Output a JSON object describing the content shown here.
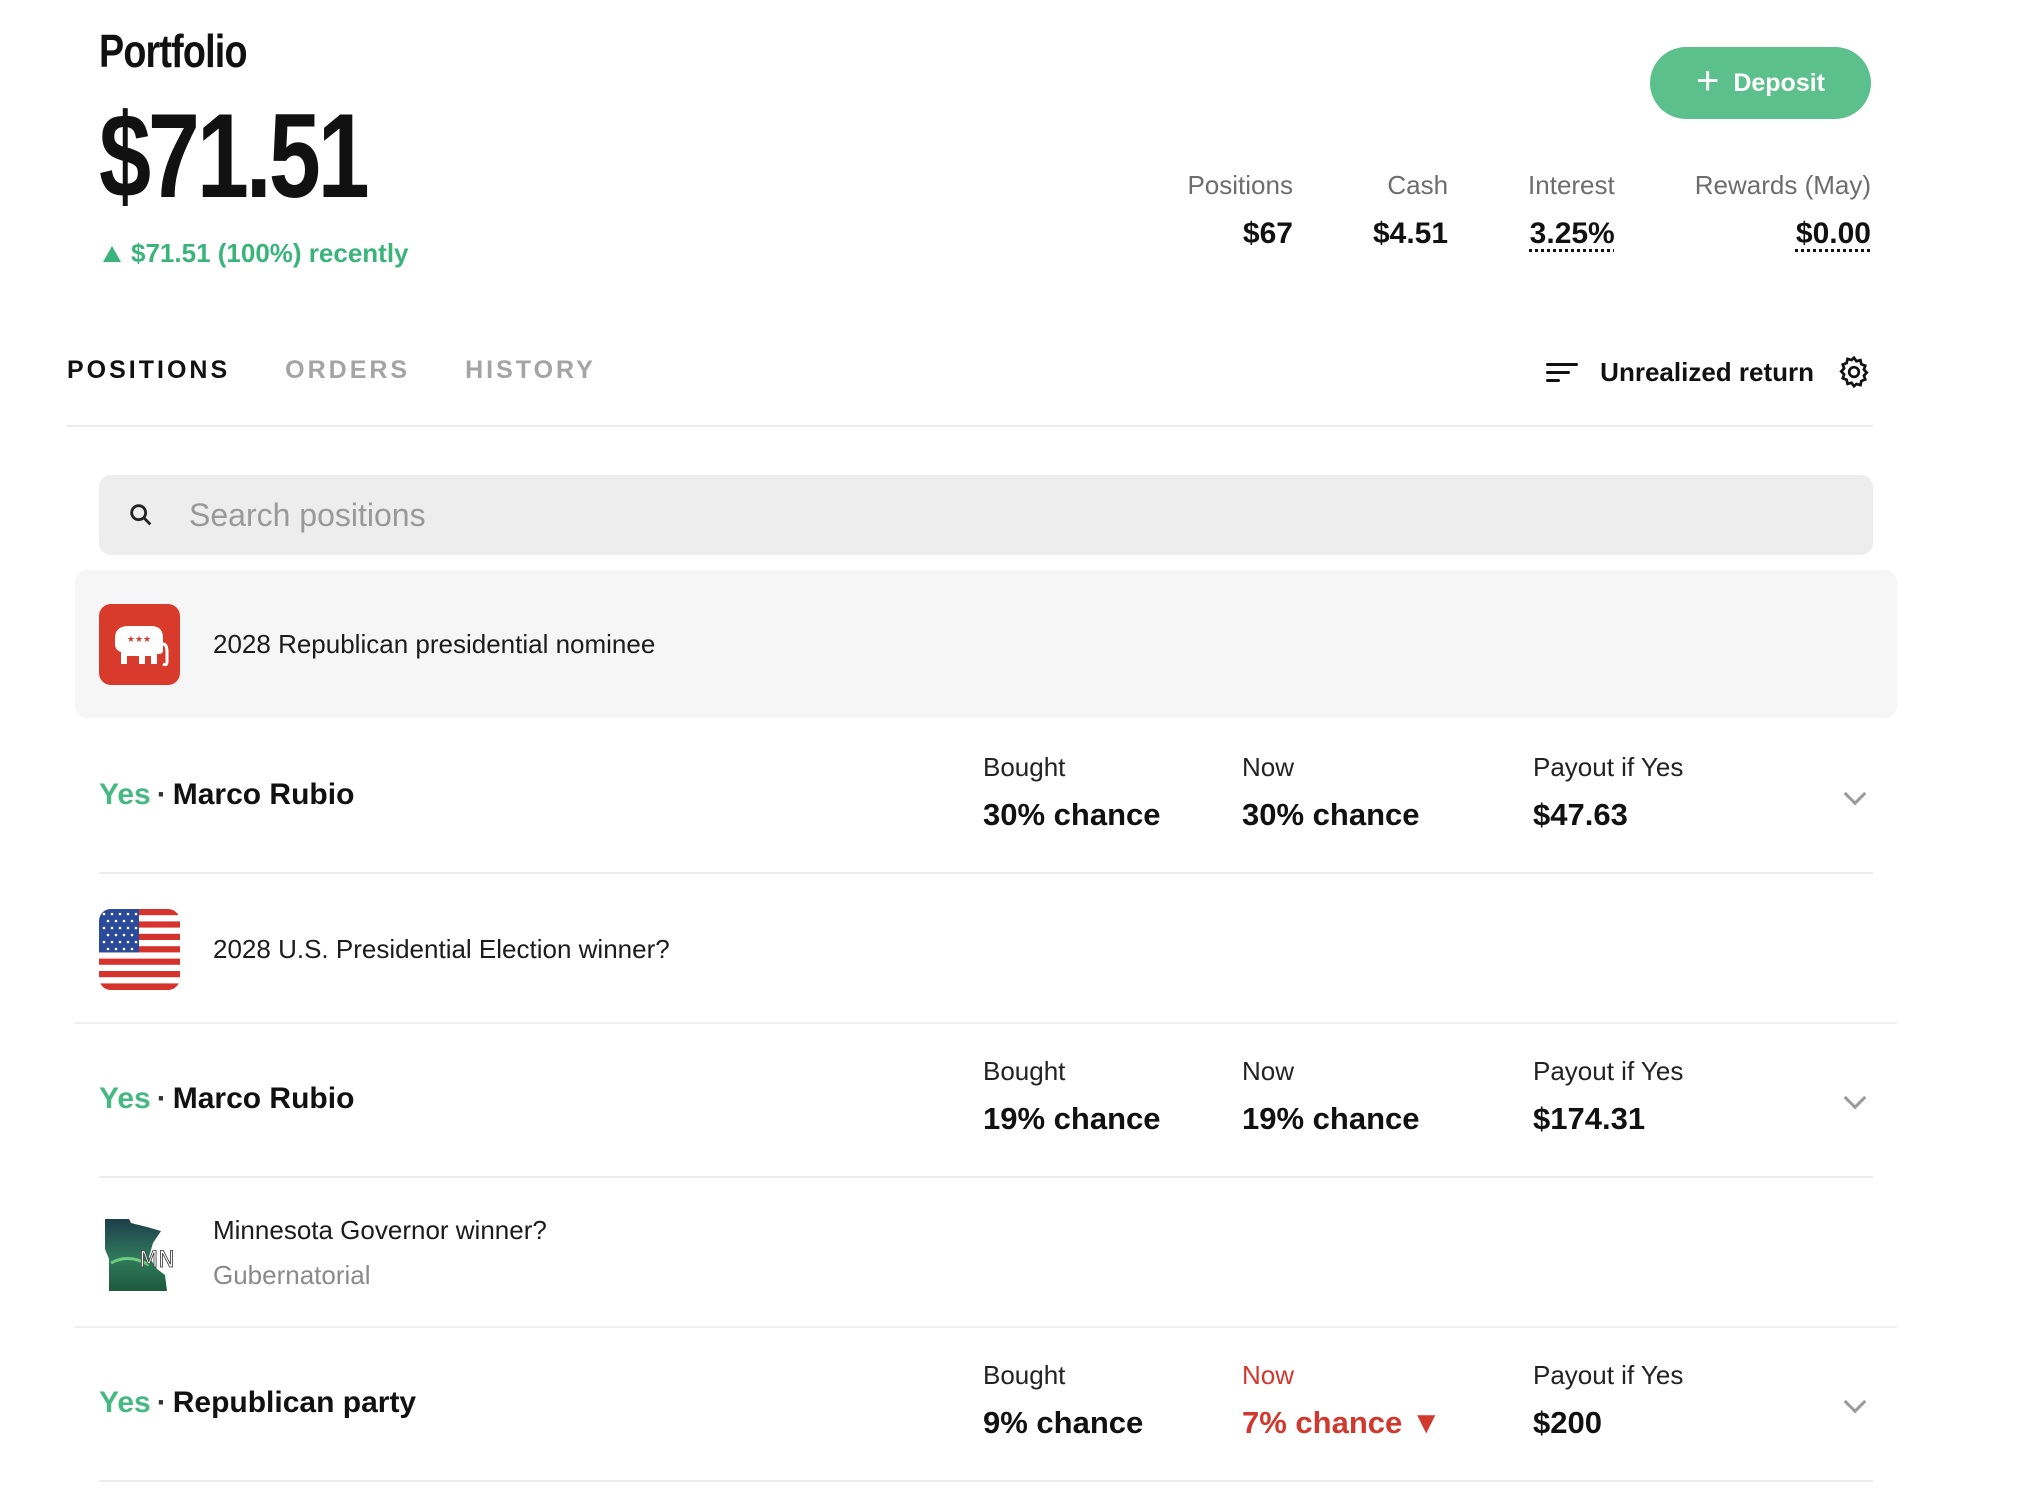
{
  "header": {
    "title": "Portfolio",
    "balance": "$71.51",
    "change": "$71.51 (100%) recently",
    "deposit_label": "Deposit"
  },
  "stats": [
    {
      "label": "Positions",
      "value": "$67"
    },
    {
      "label": "Cash",
      "value": "$4.51"
    },
    {
      "label": "Interest",
      "value": "3.25%"
    },
    {
      "label": "Rewards (May)",
      "value": "$0.00"
    }
  ],
  "tabs": [
    {
      "label": "POSITIONS",
      "active": true
    },
    {
      "label": "ORDERS",
      "active": false
    },
    {
      "label": "HISTORY",
      "active": false
    }
  ],
  "sort": {
    "label": "Unrealized return",
    "icon": "sort-icon",
    "settings_icon": "gear-icon"
  },
  "search": {
    "placeholder": "Search positions"
  },
  "markets": [
    {
      "title": "2028 Republican presidential nominee",
      "subtitle": "",
      "icon": "republican-elephant-logo",
      "position": {
        "side": "Yes",
        "name": "Marco Rubio",
        "bought_label": "Bought",
        "bought_value": "30% chance",
        "now_label": "Now",
        "now_value": "30% chance",
        "payout_label": "Payout if Yes",
        "payout_value": "$47.63"
      }
    },
    {
      "title": "2028 U.S. Presidential Election winner?",
      "subtitle": "",
      "icon": "us-flag-logo",
      "position": {
        "side": "Yes",
        "name": "Marco Rubio",
        "bought_label": "Bought",
        "bought_value": "19% chance",
        "now_label": "Now",
        "now_value": "19% chance",
        "payout_label": "Payout if Yes",
        "payout_value": "$174.31"
      }
    },
    {
      "title": "Minnesota Governor winner?",
      "subtitle": "Gubernatorial",
      "icon": "minnesota-logo",
      "logo_text": "MN",
      "position": {
        "side": "Yes",
        "name": "Republican party",
        "bought_label": "Bought",
        "bought_value": "9% chance",
        "now_label": "Now",
        "now_value": "7% chance ▼",
        "payout_label": "Payout if Yes",
        "payout_value": "$200"
      }
    }
  ],
  "colors": {
    "accent_green": "#46b982",
    "deposit_green": "#5cc08c",
    "down_red": "#d0392e"
  }
}
